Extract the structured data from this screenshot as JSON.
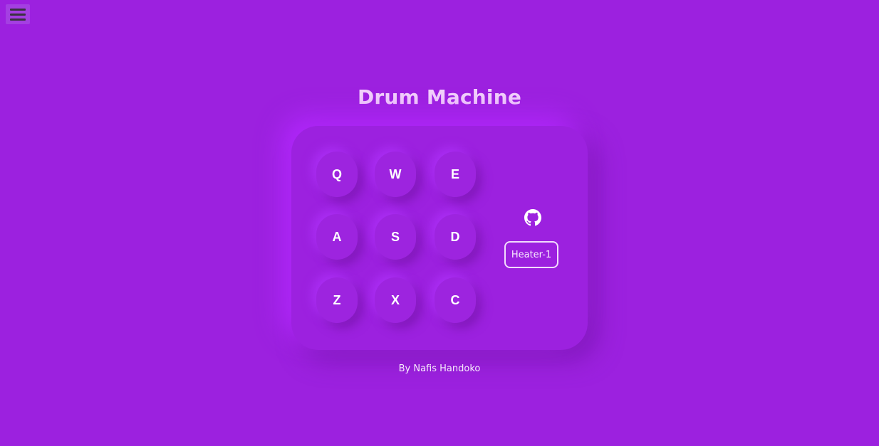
{
  "header": {
    "menu_icon": "hamburger-menu-icon",
    "title": "Drum Machine"
  },
  "pads": [
    {
      "key": "Q"
    },
    {
      "key": "W"
    },
    {
      "key": "E"
    },
    {
      "key": "A"
    },
    {
      "key": "S"
    },
    {
      "key": "D"
    },
    {
      "key": "Z"
    },
    {
      "key": "X"
    },
    {
      "key": "C"
    }
  ],
  "controls": {
    "github_icon": "github-icon",
    "bank_label": "Heater-1"
  },
  "footer": {
    "credit": "By Nafis Handoko"
  },
  "colors": {
    "background": "#9c21df",
    "title": "#f3d3fb",
    "pad_text": "#ffffff"
  }
}
